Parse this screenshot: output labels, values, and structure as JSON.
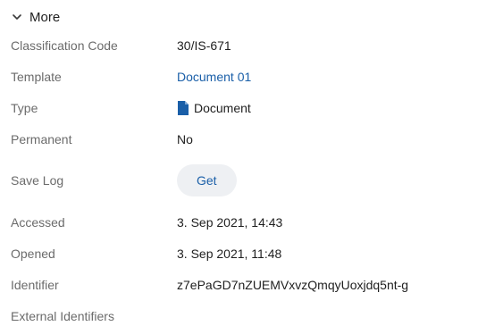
{
  "section": {
    "title": "More",
    "expanded": true,
    "chevron_icon": "chevron-down-icon"
  },
  "fields": {
    "classification_code": {
      "label": "Classification Code",
      "value": "30/IS-671"
    },
    "template": {
      "label": "Template",
      "value": "Document 01"
    },
    "type": {
      "label": "Type",
      "value": "Document",
      "icon": "document-icon"
    },
    "permanent": {
      "label": "Permanent",
      "value": "No"
    },
    "save_log": {
      "label": "Save Log",
      "button_label": "Get"
    },
    "accessed": {
      "label": "Accessed",
      "value": "3. Sep 2021, 14:43"
    },
    "opened": {
      "label": "Opened",
      "value": "3. Sep 2021, 11:48"
    },
    "identifier": {
      "label": "Identifier",
      "value": "z7ePaGD7nZUEMVxvzQmqyUoxjdq5nt-g"
    },
    "external_identifiers": {
      "label": "External Identifiers"
    }
  },
  "colors": {
    "label": "#6b6b6b",
    "value": "#1f1f1f",
    "link": "#1a5fa8",
    "button_bg": "#eef0f3",
    "icon": "#1a5fa8"
  }
}
